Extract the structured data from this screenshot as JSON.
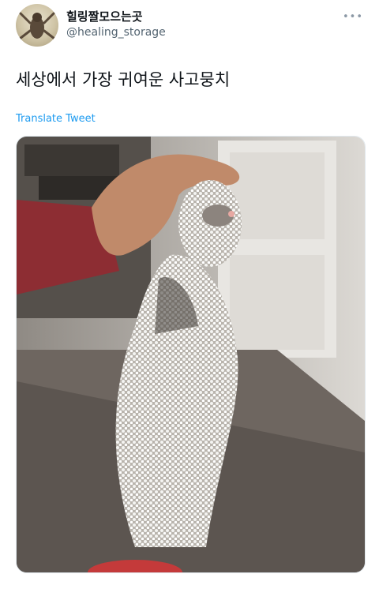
{
  "user": {
    "display_name": "힐링짤모으는곳",
    "handle": "@healing_storage"
  },
  "tweet": {
    "text": "세상에서 가장 귀여운 사고뭉치",
    "translate_label": "Translate Tweet"
  },
  "icons": {
    "more": "more-horizontal-icon"
  },
  "colors": {
    "link": "#1d9bf0",
    "secondary_text": "#536471"
  }
}
